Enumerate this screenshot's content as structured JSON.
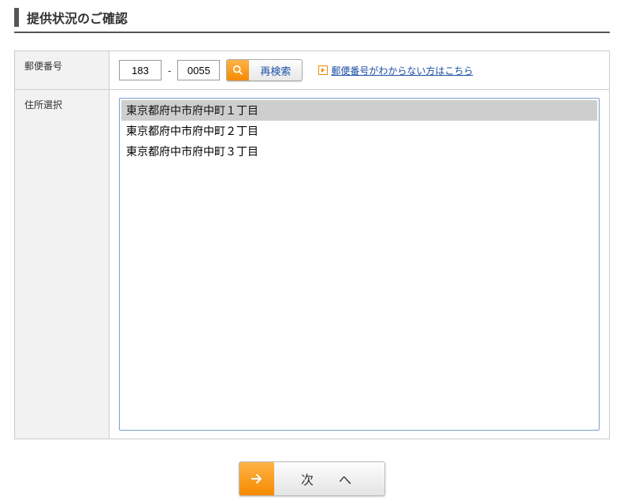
{
  "title": "提供状況のご確認",
  "labels": {
    "postal": "郵便番号",
    "address": "住所選択"
  },
  "postal": {
    "part1": "183",
    "part2": "0055",
    "research": "再検索",
    "help": "郵便番号がわからない方はこちら"
  },
  "address_options": [
    "東京都府中市府中町１丁目",
    "東京都府中市府中町２丁目",
    "東京都府中市府中町３丁目"
  ],
  "next": "次　へ"
}
